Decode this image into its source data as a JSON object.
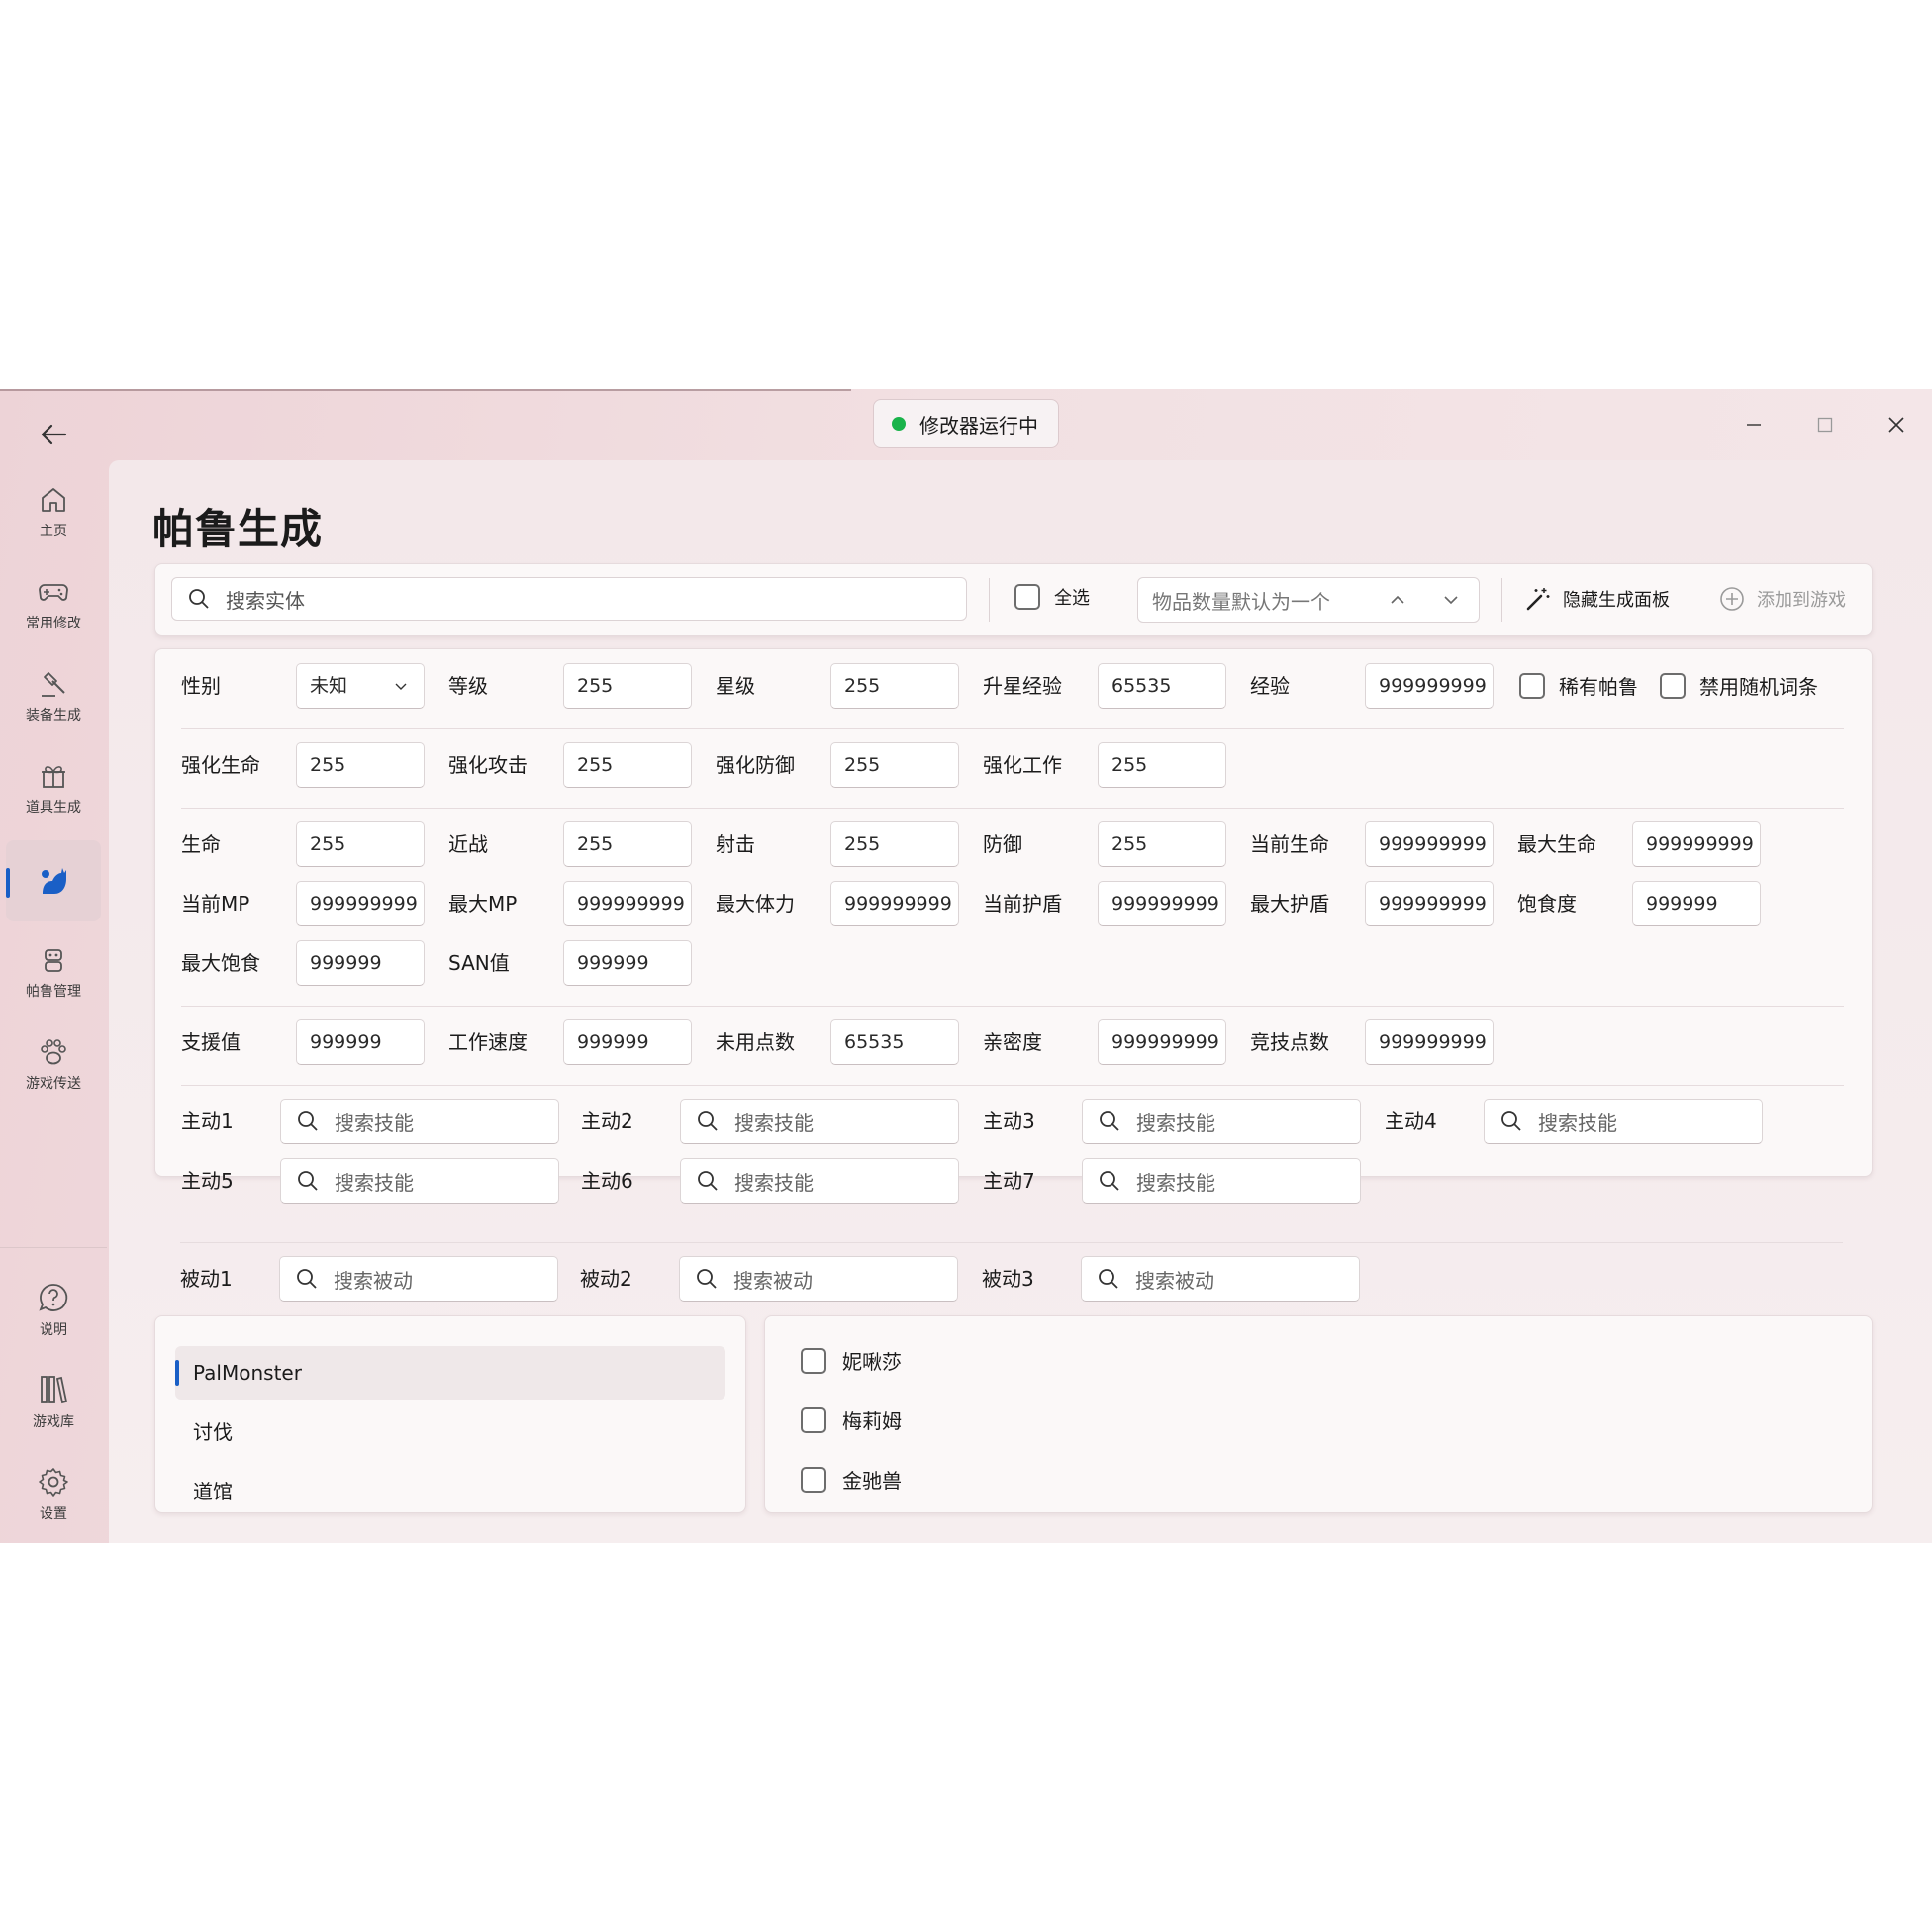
{
  "titlebar": {
    "status": "修改器运行中",
    "status_color": "#19b34a"
  },
  "sidebar": {
    "items": [
      {
        "label": "主页",
        "icon": "home-icon"
      },
      {
        "label": "常用修改",
        "icon": "gamepad-icon"
      },
      {
        "label": "装备生成",
        "icon": "hammer-icon"
      },
      {
        "label": "道具生成",
        "icon": "gift-icon"
      },
      {
        "label": "",
        "icon": "pal-cat-icon",
        "active": true
      },
      {
        "label": "帕鲁管理",
        "icon": "robot-icon"
      },
      {
        "label": "游戏传送",
        "icon": "paw-icon"
      }
    ],
    "footer": [
      {
        "label": "说明",
        "icon": "help-icon"
      },
      {
        "label": "游戏库",
        "icon": "library-icon"
      },
      {
        "label": "设置",
        "icon": "gear-icon"
      }
    ],
    "accent": "#1a5fc6"
  },
  "page": {
    "title": "帕鲁生成"
  },
  "toolbar": {
    "search_placeholder": "搜索实体",
    "select_all": "全选",
    "quantity_placeholder": "物品数量默认为一个",
    "hide_panel": "隐藏生成面板",
    "add_to_game": "添加到游戏"
  },
  "form": {
    "gender_label": "性别",
    "gender_value": "未知",
    "level_label": "等级",
    "level_value": "255",
    "star_label": "星级",
    "star_value": "255",
    "star_exp_label": "升星经验",
    "star_exp_value": "65535",
    "exp_label": "经验",
    "exp_value": "999999999",
    "rare_label": "稀有帕鲁",
    "no_random_label": "禁用随机词条",
    "boost_hp_label": "强化生命",
    "boost_hp_value": "255",
    "boost_atk_label": "强化攻击",
    "boost_atk_value": "255",
    "boost_def_label": "强化防御",
    "boost_def_value": "255",
    "boost_work_label": "强化工作",
    "boost_work_value": "255",
    "hp_label": "生命",
    "hp_value": "255",
    "melee_label": "近战",
    "melee_value": "255",
    "shot_label": "射击",
    "shot_value": "255",
    "def_label": "防御",
    "def_value": "255",
    "cur_hp_label": "当前生命",
    "cur_hp_value": "999999999",
    "max_hp_label": "最大生命",
    "max_hp_value": "999999999",
    "cur_mp_label": "当前MP",
    "cur_mp_value": "999999999",
    "max_mp_label": "最大MP",
    "max_mp_value": "999999999",
    "max_sp_label": "最大体力",
    "max_sp_value": "999999999",
    "cur_shield_label": "当前护盾",
    "cur_shield_value": "999999999",
    "max_shield_label": "最大护盾",
    "max_shield_value": "999999999",
    "satiety_label": "饱食度",
    "satiety_value": "999999",
    "max_satiety_label": "最大饱食",
    "max_satiety_value": "999999",
    "san_label": "SAN值",
    "san_value": "999999",
    "support_label": "支援值",
    "support_value": "999999",
    "work_speed_label": "工作速度",
    "work_speed_value": "999999",
    "unused_points_label": "未用点数",
    "unused_points_value": "65535",
    "intimacy_label": "亲密度",
    "intimacy_value": "999999999",
    "arena_points_label": "竞技点数",
    "arena_points_value": "999999999",
    "active_skills": [
      {
        "label": "主动1",
        "placeholder": "搜索技能"
      },
      {
        "label": "主动2",
        "placeholder": "搜索技能"
      },
      {
        "label": "主动3",
        "placeholder": "搜索技能"
      },
      {
        "label": "主动4",
        "placeholder": "搜索技能"
      },
      {
        "label": "主动5",
        "placeholder": "搜索技能"
      },
      {
        "label": "主动6",
        "placeholder": "搜索技能"
      },
      {
        "label": "主动7",
        "placeholder": "搜索技能"
      }
    ],
    "passive_skills": [
      {
        "label": "被动1",
        "placeholder": "搜索被动"
      },
      {
        "label": "被动2",
        "placeholder": "搜索被动"
      },
      {
        "label": "被动3",
        "placeholder": "搜索被动"
      }
    ]
  },
  "categories": [
    "PalMonster",
    "讨伐",
    "道馆"
  ],
  "pals": [
    "妮啾莎",
    "梅莉姆",
    "金驰兽"
  ]
}
